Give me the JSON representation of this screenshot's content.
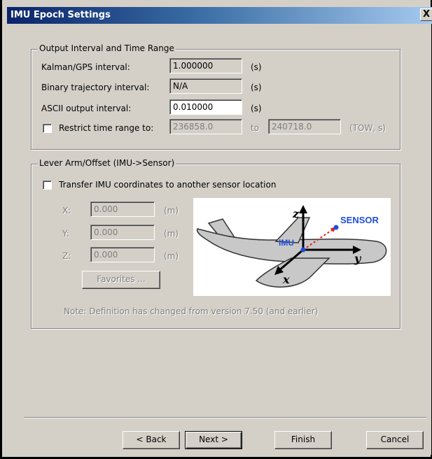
{
  "window": {
    "title": "IMU Epoch Settings",
    "close_glyph": "X"
  },
  "output_group": {
    "legend": "Output Interval and Time Range",
    "kalman_label": "Kalman/GPS interval:",
    "kalman_value": "1.000000",
    "kalman_unit": "(s)",
    "binary_label": "Binary trajectory interval:",
    "binary_value": "N/A",
    "binary_unit": "(s)",
    "ascii_label": "ASCII output interval:",
    "ascii_value": "0.010000",
    "ascii_unit": "(s)",
    "restrict_label": "Restrict time range to:",
    "restrict_checked": false,
    "range_start": "236858.0",
    "range_to": "to",
    "range_end": "240718.0",
    "range_unit": "(TOW, s)"
  },
  "lever_group": {
    "legend": "Lever Arm/Offset (IMU->Sensor)",
    "transfer_label": "Transfer IMU coordinates to another sensor location",
    "transfer_checked": false,
    "x_label": "X:",
    "x_value": "0.000",
    "x_unit": "(m)",
    "y_label": "Y:",
    "y_value": "0.000",
    "y_unit": "(m)",
    "z_label": "Z:",
    "z_value": "0.000",
    "z_unit": "(m)",
    "favorites_label": "Favorites ...",
    "note": "Note: Definition has changed from version 7.50 (and earlier)",
    "diagram": {
      "axis_z": "z",
      "axis_y": "y",
      "axis_x": "x",
      "imu_label": "IMU",
      "sensor_label": "SENSOR",
      "colors": {
        "imu_text": "#1f4fd8",
        "sensor_text": "#1f4fd8",
        "offset_arrow": "#e02020",
        "plane_fill": "#c8c8c8"
      }
    }
  },
  "footer": {
    "back_label": "< Back",
    "next_label": "Next >",
    "finish_label": "Finish",
    "cancel_label": "Cancel"
  }
}
